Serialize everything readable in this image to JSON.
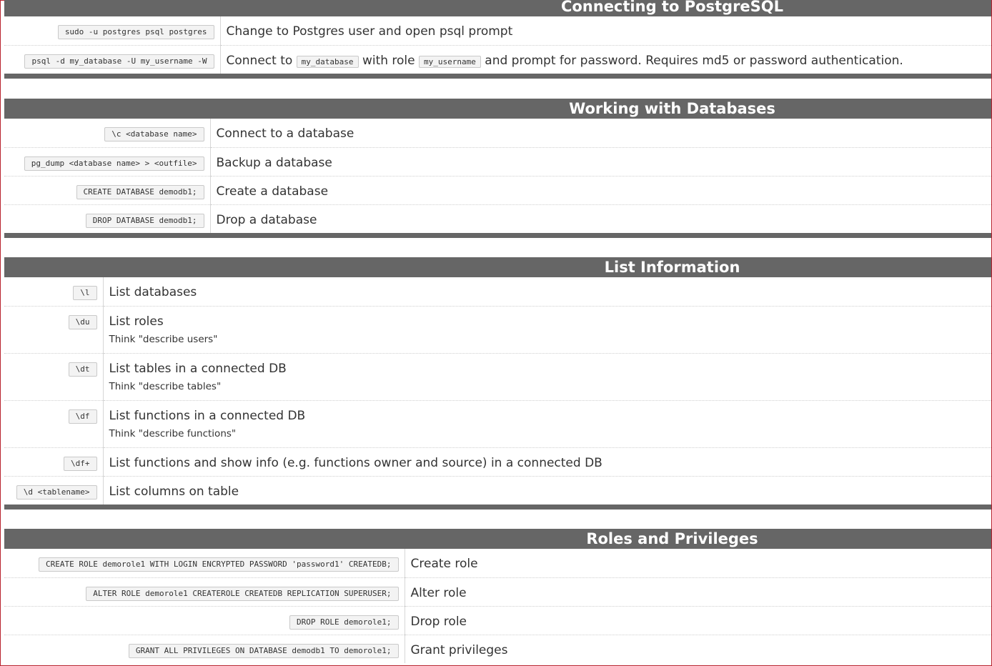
{
  "sections": [
    {
      "title": "Connecting to PostgreSQL",
      "rows": [
        {
          "cmd": "sudo -u postgres psql postgres",
          "desc": "Change to Postgres user and open psql prompt"
        },
        {
          "cmd": "psql -d my_database -U my_username -W",
          "desc_pre": "Connect to",
          "code1": "my_database",
          "desc_mid": "with role",
          "code2": "my_username",
          "desc_post": "and prompt for password. Requires md5 or password authentication."
        }
      ]
    },
    {
      "title": "Working with Databases",
      "rows": [
        {
          "cmd": "\\c <database name>",
          "desc": "Connect to a database"
        },
        {
          "cmd": "pg_dump <database name> > <outfile>",
          "desc": "Backup a database"
        },
        {
          "cmd": "CREATE DATABASE demodb1;",
          "desc": "Create a database"
        },
        {
          "cmd": "DROP DATABASE demodb1;",
          "desc": "Drop a database"
        }
      ]
    },
    {
      "title": "List Information",
      "rows": [
        {
          "cmd": "\\l",
          "desc": "List databases"
        },
        {
          "cmd": "\\du",
          "desc": "List roles",
          "note": "Think \"describe users\""
        },
        {
          "cmd": "\\dt",
          "desc": "List tables in a connected DB",
          "note": "Think \"describe tables\""
        },
        {
          "cmd": "\\df",
          "desc": "List functions in a connected DB",
          "note": "Think \"describe functions\""
        },
        {
          "cmd": "\\df+",
          "desc": "List functions and show info (e.g. functions owner and source) in a connected DB"
        },
        {
          "cmd": "\\d <tablename>",
          "desc": "List columns on table"
        }
      ]
    },
    {
      "title": "Roles and Privileges",
      "rows": [
        {
          "cmd": "CREATE ROLE demorole1 WITH LOGIN ENCRYPTED PASSWORD 'password1' CREATEDB;",
          "desc": "Create role"
        },
        {
          "cmd": "ALTER ROLE demorole1 CREATEROLE CREATEDB REPLICATION SUPERUSER;",
          "desc": "Alter role"
        },
        {
          "cmd": "DROP ROLE demorole1;",
          "desc": "Drop role"
        },
        {
          "cmd": "GRANT ALL PRIVILEGES ON DATABASE demodb1 TO demorole1;",
          "desc": "Grant privileges"
        }
      ]
    }
  ]
}
